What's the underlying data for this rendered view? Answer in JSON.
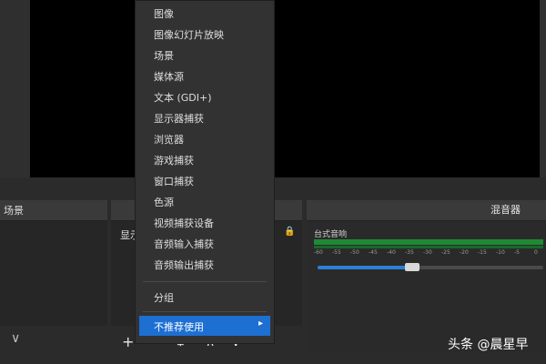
{
  "docks": {
    "scenes": {
      "title": "场景",
      "footer_icon": "chevron-down"
    },
    "sources": {
      "title": "",
      "items": [
        "显示"
      ],
      "toolbar": {
        "add": "+",
        "remove": "−",
        "settings": "⚙",
        "up": "∧",
        "down": "∨"
      }
    },
    "mixer": {
      "title": "混音器",
      "track": "台式音响",
      "scale": [
        "-60",
        "-55",
        "-50",
        "-45",
        "-40",
        "-35",
        "-30",
        "-25",
        "-20",
        "-15",
        "-10",
        "-5",
        "0"
      ],
      "volume_fraction": 0.4
    }
  },
  "menu": {
    "items": [
      "图像",
      "图像幻灯片放映",
      "场景",
      "媒体源",
      "文本 (GDI+)",
      "显示器捕获",
      "浏览器",
      "游戏捕获",
      "窗口捕获",
      "色源",
      "视频捕获设备",
      "音频输入捕获",
      "音频输出捕获"
    ],
    "group": "分组",
    "deprecated": "不推荐使用",
    "submenu_arrow": "▸"
  },
  "watermark": "头条 @晨星早",
  "colors": {
    "menu_bg": "#323232",
    "highlight": "#1d6fd2",
    "meter": "#1e8a34",
    "slider": "#2c7fd6"
  }
}
